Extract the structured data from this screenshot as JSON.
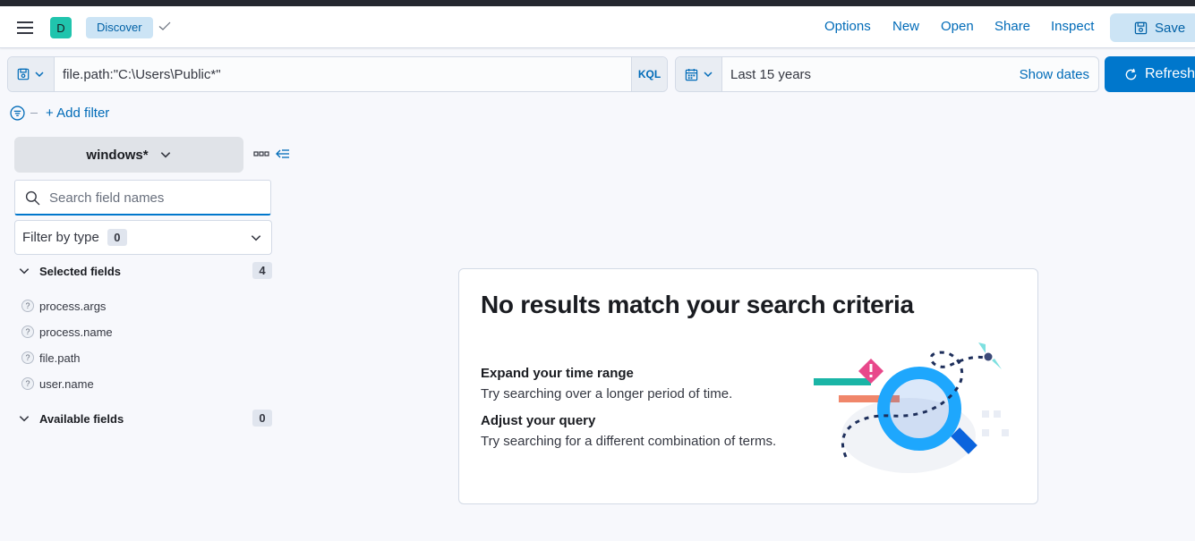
{
  "header": {
    "avatar_letter": "D",
    "breadcrumb": "Discover",
    "links": [
      "Options",
      "New",
      "Open",
      "Share",
      "Inspect"
    ],
    "save_label": "Save"
  },
  "query_bar": {
    "query_value": "file.path:\"C:\\Users\\Public*\"",
    "language_label": "KQL"
  },
  "date_picker": {
    "range_label": "Last 15 years",
    "show_dates_label": "Show dates"
  },
  "refresh_label": "Refresh",
  "filters": {
    "add_filter_label": "+ Add filter"
  },
  "sidebar": {
    "data_view": "windows*",
    "search_placeholder": "Search field names",
    "filter_by_type_label": "Filter by type",
    "filter_by_type_count": "0",
    "selected_fields_label": "Selected fields",
    "selected_fields_count": "4",
    "selected_fields": [
      "process.args",
      "process.name",
      "file.path",
      "user.name"
    ],
    "field_type_glyph": "?",
    "available_fields_label": "Available fields",
    "available_fields_count": "0"
  },
  "empty_state": {
    "title": "No results match your search criteria",
    "tips": [
      {
        "title": "Expand your time range",
        "text": "Try searching over a longer period of time."
      },
      {
        "title": "Adjust your query",
        "text": "Try searching for a different combination of terms."
      }
    ]
  },
  "colors": {
    "primary": "#0077cc",
    "link": "#006bb8",
    "avatar": "#20c4ad",
    "breadcrumb_bg": "#cce4f5"
  }
}
